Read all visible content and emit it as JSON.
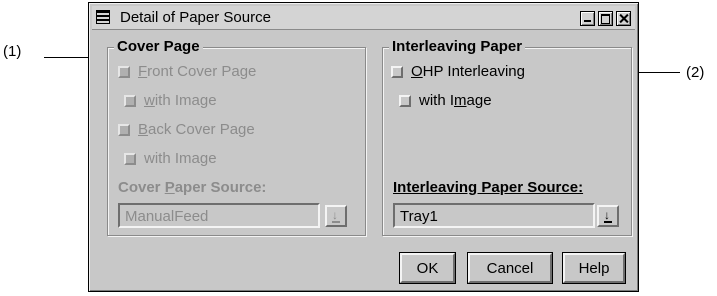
{
  "callouts": {
    "left": "(1)",
    "right": "(2)"
  },
  "window": {
    "title": "Detail of Paper Source",
    "controls": [
      "minimize",
      "maximize",
      "close"
    ]
  },
  "cover_page": {
    "title": "Cover Page",
    "front_cover": {
      "mnemonic": "F",
      "rest": "ront Cover Page",
      "checked": false,
      "enabled": false
    },
    "front_with_image": {
      "prefix": "",
      "mnemonic": "w",
      "rest": "ith Image",
      "checked": false,
      "enabled": false
    },
    "back_cover": {
      "mnemonic": "B",
      "rest": "ack Cover Page",
      "checked": false,
      "enabled": false
    },
    "back_with_image": {
      "label": "with Image",
      "checked": false,
      "enabled": false
    },
    "source_label": {
      "pre": "Cover ",
      "mnemonic": "P",
      "post": "aper Source:"
    },
    "source_value": "ManualFeed"
  },
  "interleaving": {
    "title": "Interleaving Paper",
    "ohp": {
      "mnemonic": "O",
      "rest": "HP Interleaving",
      "checked": false,
      "enabled": true
    },
    "with_image": {
      "pre": "with I",
      "mnemonic": "m",
      "post": "age",
      "checked": false,
      "enabled": true
    },
    "source_label": "Interleaving Paper Source:",
    "source_value": "Tray1"
  },
  "buttons": {
    "ok": "OK",
    "cancel": "Cancel",
    "help": "Help"
  },
  "icons": {
    "menu": "window-menu-icon",
    "dropdown": "dropdown-arrow-icon"
  }
}
